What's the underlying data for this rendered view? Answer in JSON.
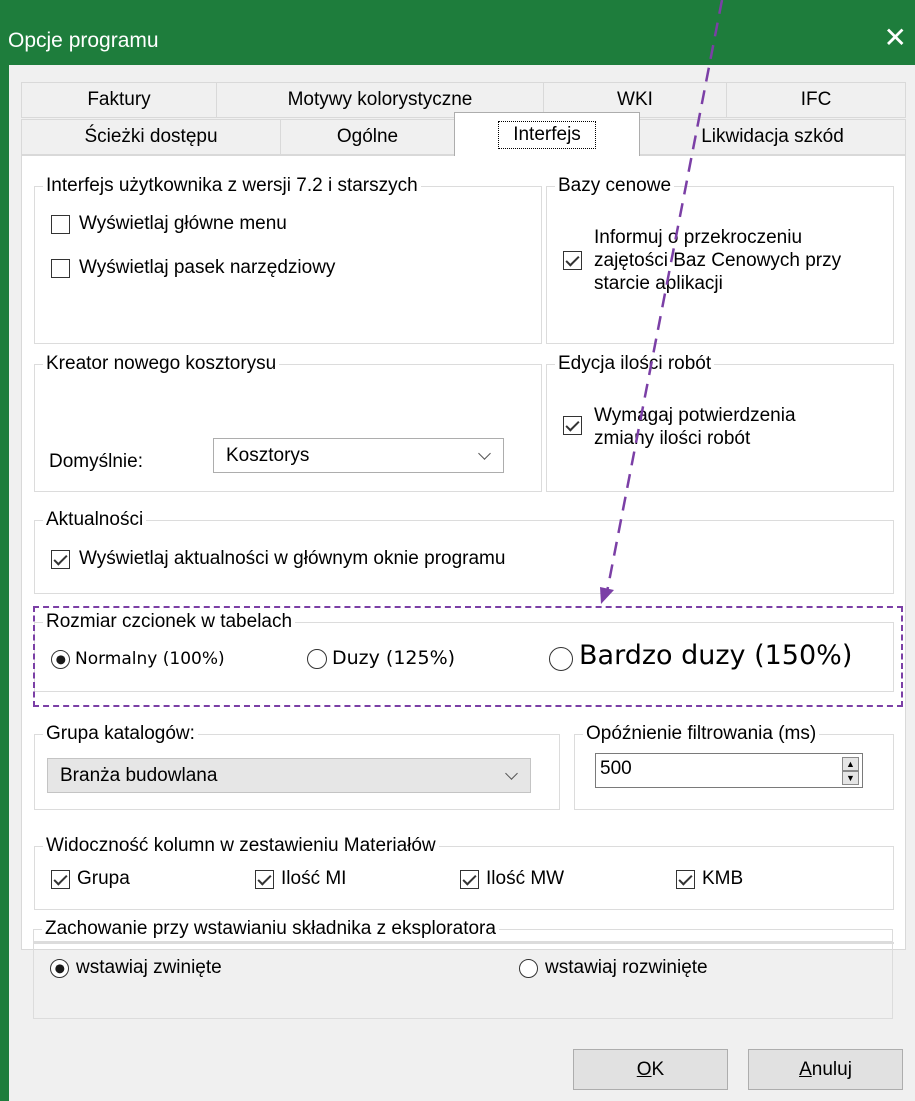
{
  "window": {
    "title": "Opcje programu",
    "close_glyph": "✕"
  },
  "tabs_row1": [
    "Faktury",
    "Motywy kolorystyczne",
    "WKI",
    "IFC"
  ],
  "tabs_row2": [
    "Ścieżki dostępu",
    "Ogólne",
    "Interfejs",
    "Likwidacja szkód"
  ],
  "active_tab": "Interfejs",
  "groups": {
    "ui_legacy": {
      "title": "Interfejs użytkownika z wersji 7.2 i starszych",
      "show_menu": {
        "label": "Wyświetlaj główne menu",
        "checked": false
      },
      "show_toolbar": {
        "label": "Wyświetlaj pasek narzędziowy",
        "checked": false
      }
    },
    "price_db": {
      "title": "Bazy cenowe",
      "notify": {
        "line1": "Informuj o przekroczeniu",
        "line2": "zajętości Baz Cenowych przy",
        "line3": "starcie aplikacji",
        "checked": true
      }
    },
    "wizard": {
      "title": "Kreator nowego kosztorysu",
      "default_label": "Domyślnie:",
      "default_value": "Kosztorys"
    },
    "qty_edit": {
      "title": "Edycja ilości robót",
      "confirm": {
        "line1": "Wymagaj potwierdzenia",
        "line2": "zmiany ilości robót",
        "checked": true
      }
    },
    "news": {
      "title": "Aktualności",
      "show_news": {
        "label": "Wyświetlaj aktualności w głównym oknie programu",
        "checked": true
      }
    },
    "font_size": {
      "title": "Rozmiar czcionek w tabelach",
      "options": [
        {
          "label": "Normalny (100%)",
          "checked": true
        },
        {
          "label": "Duzy (125%)",
          "checked": false
        },
        {
          "label": "Bardzo duzy (150%)",
          "checked": false
        }
      ]
    },
    "catalog_group": {
      "title": "Grupa katalogów:",
      "value": "Branża budowlana"
    },
    "filter_delay": {
      "title": "Opóźnienie filtrowania (ms)",
      "value": "500"
    },
    "material_columns": {
      "title": "Widoczność kolumn w zestawieniu Materiałów",
      "options": [
        {
          "label": "Grupa",
          "checked": true
        },
        {
          "label": "Ilość MI",
          "checked": true
        },
        {
          "label": "Ilość MW",
          "checked": true
        },
        {
          "label": "KMB",
          "checked": true
        }
      ]
    },
    "insert_behaviour": {
      "title": "Zachowanie przy wstawianiu składnika z eksploratora",
      "options": [
        {
          "label": "wstawiaj zwinięte",
          "checked": true
        },
        {
          "label": "wstawiaj rozwinięte",
          "checked": false
        }
      ]
    }
  },
  "buttons": {
    "ok": {
      "accel": "O",
      "rest": "K"
    },
    "cancel": {
      "accel": "A",
      "rest": "nuluj"
    }
  },
  "annotation": {
    "color": "#7b3fa6"
  },
  "colors": {
    "titlebar": "#1e7d3c"
  }
}
